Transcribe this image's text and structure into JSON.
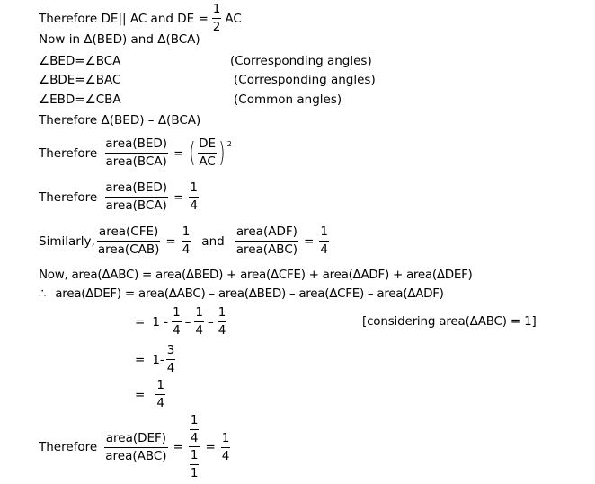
{
  "lines": {
    "l1": {
      "text": "Therefore DE|| AC and DE =",
      "frac_num": "1",
      "frac_den": "2",
      "tail": "AC"
    },
    "l2": {
      "text": "Now in Δ(BED)  and Δ(BCA)"
    },
    "l3": {
      "text": "∠BED=∠BCA",
      "reason": "(Corresponding angles)"
    },
    "l4": {
      "text": "∠BDE=∠BAC",
      "reason": "(Corresponding angles)"
    },
    "l5": {
      "text": "∠EBD=∠CBA",
      "reason": "(Common angles)"
    },
    "l6": {
      "text": "Therefore Δ(BED) – Δ(BCA)"
    },
    "l7": {
      "label": "Therefore",
      "num": "area(BED)",
      "den": "area(BCA)",
      "eq": "=",
      "rnum": "DE",
      "rden": "AC",
      "exp": "2"
    },
    "l8": {
      "label": "Therefore",
      "num": "area(BED)",
      "den": "area(BCA)",
      "eq": "=",
      "rnum": "1",
      "rden": "4"
    },
    "l9": {
      "label": "Similarly,",
      "num": "area(CFE)",
      "den": "area(CAB)",
      "eq": "=",
      "rnum": "1",
      "rden": "4",
      "and": "and",
      "num2": "area(ADF)",
      "den2": "area(ABC)",
      "eq2": "=",
      "rnum2": "1",
      "rden2": "4"
    },
    "l10": {
      "text": "Now, area(ΔABC) = area(ΔBED) + area(ΔCFE) + area(ΔADF) + area(ΔDEF)"
    },
    "l11": {
      "therefore_symbol": "∴",
      "text": "area(ΔDEF)  =  area(ΔABC) –  area(ΔBED) – area(ΔCFE) – area(ΔADF)"
    },
    "l12": {
      "eq": "=",
      "one": "1 -",
      "f1n": "1",
      "f1d": "4",
      "m1": "–",
      "f2n": "1",
      "f2d": "4",
      "m2": "–",
      "f3n": "1",
      "f3d": "4",
      "note": "[considering area(ΔABC) = 1]"
    },
    "l13": {
      "eq": "=",
      "one": "1-",
      "fn": "3",
      "fd": "4"
    },
    "l14": {
      "eq": "=",
      "fn": "1",
      "fd": "4"
    },
    "l15": {
      "label": "Therefore",
      "num": "area(DEF)",
      "den": "area(ABC)",
      "eq": "=",
      "cnn": "1",
      "cnd": "4",
      "cdn": "1",
      "cdd": "1",
      "eq2": "=",
      "rnum": "1",
      "rden": "4"
    }
  }
}
